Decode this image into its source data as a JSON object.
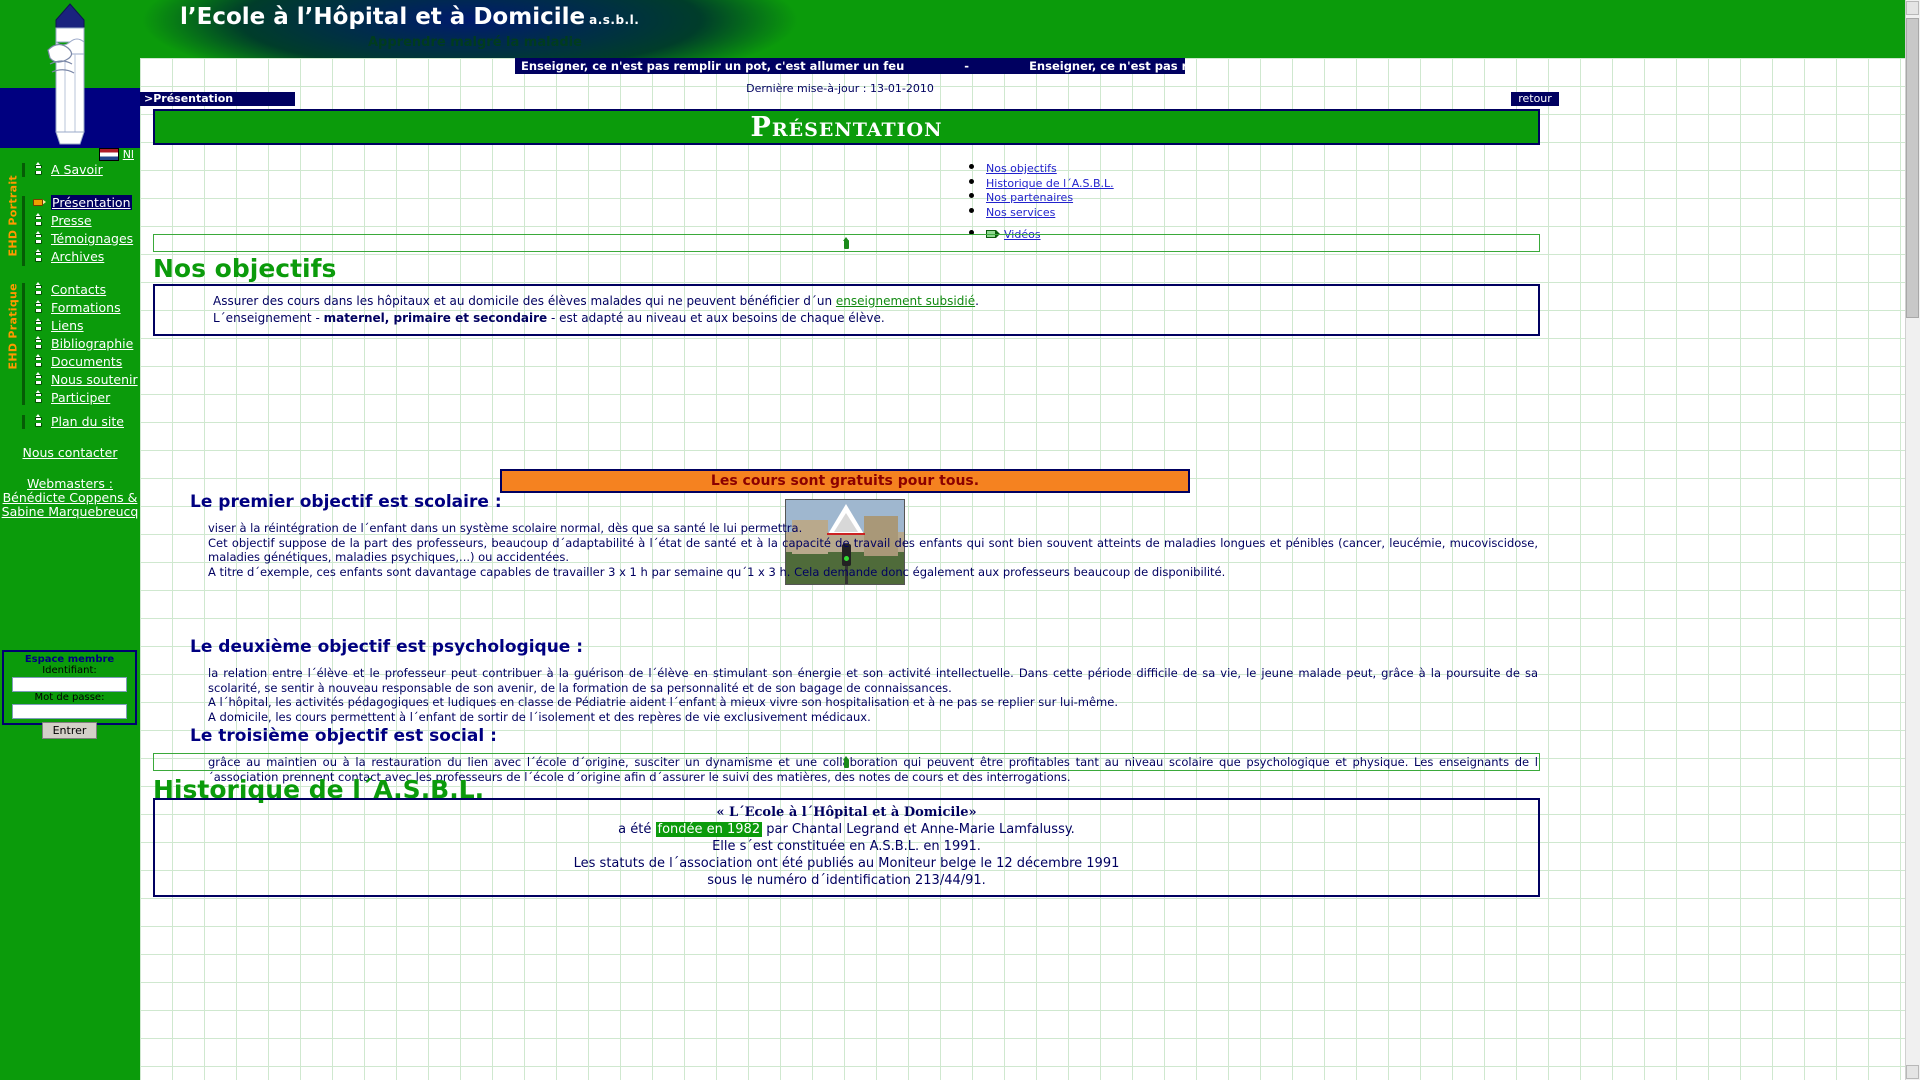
{
  "header": {
    "site_title": "l’Ecole à l’Hôpital et à Domicile",
    "asbl": "a.s.b.l.",
    "tagline": "Apprendre malgré la maladie"
  },
  "sidebar": {
    "lang": {
      "code": "Nl",
      "flag": "nl-flag"
    },
    "top_item": {
      "label": "A Savoir",
      "icon": "pencil-icon"
    },
    "groups": [
      {
        "rail_label": "EHD  Portrait",
        "items": [
          {
            "label": "Présentation",
            "icon": "pencil-horizontal-icon",
            "active": true
          },
          {
            "label": "Presse",
            "icon": "pencil-icon",
            "active": false
          },
          {
            "label": "Témoignages",
            "icon": "pencil-icon",
            "active": false
          },
          {
            "label": "Archives",
            "icon": "pencil-icon",
            "active": false
          }
        ]
      },
      {
        "rail_label": "EHD  Pratique",
        "items": [
          {
            "label": "Contacts",
            "icon": "pencil-icon",
            "active": false
          },
          {
            "label": "Formations",
            "icon": "pencil-icon",
            "active": false
          },
          {
            "label": "Liens",
            "icon": "pencil-icon",
            "active": false
          },
          {
            "label": "Bibliographie",
            "icon": "pencil-icon",
            "active": false
          },
          {
            "label": "Documents",
            "icon": "pencil-icon",
            "active": false
          },
          {
            "label": "Nous soutenir",
            "icon": "pencil-icon",
            "active": false
          },
          {
            "label": "Participer",
            "icon": "pencil-icon",
            "active": false
          }
        ]
      },
      {
        "rail_label": "",
        "items": [
          {
            "label": "Plan du site",
            "icon": "pencil-icon",
            "active": false
          }
        ]
      }
    ],
    "contact_link": "Nous contacter",
    "webmasters_label": "Webmasters :",
    "webmaster_1": "Bénédicte Coppens &",
    "webmaster_2": "Sabine Marquebreucq",
    "login": {
      "title": "Espace membre",
      "user_label": "Identifiant:",
      "user_value": "",
      "user_placeholder": "",
      "pass_label": "Mot de passe:",
      "pass_value": "",
      "pass_placeholder": "",
      "submit_label": "Entrer"
    }
  },
  "topbar": {
    "marquee_text": "Enseigner, ce n'est pas remplir un pot, c'est allumer un feu",
    "marquee_separator": "-",
    "last_update": "Dernière mise-à-jour : 13-01-2010",
    "breadcrumb": ">Présentation",
    "back_label": "retour"
  },
  "main": {
    "page_title": "Présentation",
    "toc": [
      {
        "label": "Nos objectifs",
        "icon": null
      },
      {
        "label": "Historique de l´A.S.B.L.",
        "icon": null
      },
      {
        "label": "Nos partenaires",
        "icon": null
      },
      {
        "label": "Nos services",
        "icon": null
      },
      {
        "label": "Vidéos",
        "icon": "video-icon"
      }
    ],
    "objectives_heading": "Nos objectifs",
    "intro": {
      "line1_a": "Assurer des cours dans les hôpitaux et au domicile des élèves malades qui ne peuvent bénéficier d´un ",
      "line1_link": "enseignement subsidié",
      "line1_b": ".",
      "line2_a": "L´enseignement - ",
      "line2_bold": "maternel, primaire et secondaire",
      "line2_b": " - est adapté au niveau et aux besoins de chaque élève."
    },
    "free_banner": "Les cours sont gratuits pour tous.",
    "photo_alt": "school-building-photo",
    "objective_1": {
      "heading": "Le premier objectif est scolaire :",
      "paragraphs": [
        "viser à la réintégration de l´enfant dans un système scolaire normal, dès que sa santé le lui permettra.",
        "Cet objectif suppose de la part des professeurs, beaucoup d´adaptabilité à l´état de santé et à la capacité de travail des enfants qui sont bien souvent atteints de maladies longues et pénibles (cancer, leucémie, mucoviscidose, maladies génétiques, maladies psychiques,...) ou accidentées.",
        "A titre d´exemple, ces enfants sont davantage capables de travailler 3 x 1 h par semaine qu´1 x 3 h. Cela demande donc également aux professeurs beaucoup de disponibilité."
      ]
    },
    "objective_2": {
      "heading": "Le deuxième objectif est psychologique :",
      "paragraphs": [
        "la relation entre l´élève et le professeur peut contribuer à la guérison de l´élève en stimulant son énergie et son activité intellectuelle. Dans cette période difficile de sa vie, le jeune malade peut, grâce à la poursuite de sa scolarité, se sentir à nouveau responsable de son avenir, de la formation de sa personnalité et de son bagage de connaissances.",
        "A l´hôpital, les activités pédagogiques et ludiques en classe de Pédiatrie aident l´enfant à mieux vivre son hospitalisation et à ne pas se replier sur lui-même.",
        "A domicile, les cours permettent à l´enfant de sortir de l´isolement et des repères de vie exclusivement médicaux."
      ]
    },
    "objective_3": {
      "heading": "Le troisième objectif est social :",
      "paragraphs": [
        "grâce au maintien ou à la restauration du lien avec l´école d´origine, susciter un dynamisme et une collaboration qui peuvent être profitables tant au niveau scolaire que psychologique et physique. Les enseignants de l´association prennent contact avec les professeurs de l´école d´origine afin d´assurer le suivi des matières, des notes de cours et des interrogations."
      ]
    },
    "history_heading": "Historique de l´A.S.B.L.",
    "history": {
      "title": "« L´Ecole à l´Hôpital et à Domicile»",
      "line2_a": "a été ",
      "line2_hl": "fondée en 1982",
      "line2_b": " par Chantal Legrand et Anne-Marie Lamfalussy.",
      "line3": "Elle s´est constituée en A.S.B.L. en 1991.",
      "line4": "Les statuts de l´association ont été publiés au Moniteur belge le 12 décembre 1991",
      "line5": "sous le numéro d´identification 213/44/91."
    }
  },
  "colors": {
    "green": "#0b9b0b",
    "navy": "#000060",
    "orange": "#f58220",
    "link_blue": "#2222cc",
    "rail_orange": "#ff9900"
  }
}
